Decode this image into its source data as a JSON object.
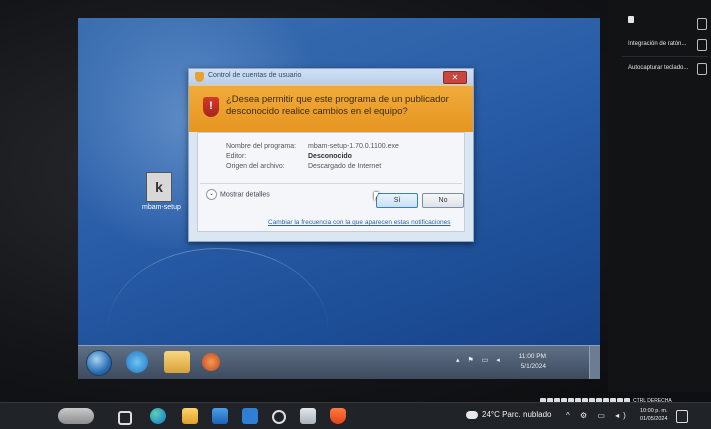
{
  "uac": {
    "title": "Control de cuentas de usuario",
    "close": "✕",
    "question": "¿Desea permitir que este programa de un publicador desconocido realice cambios en el equipo?",
    "program_name_label": "Nombre del programa:",
    "program_name_value": "mbam-setup-1.70.0.1100.exe",
    "publisher_label": "Editor:",
    "publisher_value": "Desconocido",
    "origin_label": "Origen del archivo:",
    "origin_value": "Descargado de Internet",
    "details_toggle": "Mostrar detalles",
    "yes_button": "Sí",
    "no_button": "No",
    "frequency_link": "Cambiar la frecuencia con la que aparecen estas notificaciones",
    "shield_glyph": "!"
  },
  "vm": {
    "desktop_icon_glyph": "k",
    "desktop_icon_label": "mbam-setup",
    "tray_icons": "▴ ⚑ ▭ ◂",
    "clock_time": "11:00 PM",
    "clock_date": "5/1/2024"
  },
  "notifications": {
    "items": [
      "Integración de ratón...",
      "Autocapturar teclado..."
    ]
  },
  "host_strip": {
    "keyboard_label": "CTRL DERECHA"
  },
  "host_taskbar": {
    "weather": "24°C  Parc. nublado",
    "tray_icons": "^ ⚙ ▭ ◂)",
    "clock_time": "10:00 p. m.",
    "clock_date": "01/05/2024"
  }
}
